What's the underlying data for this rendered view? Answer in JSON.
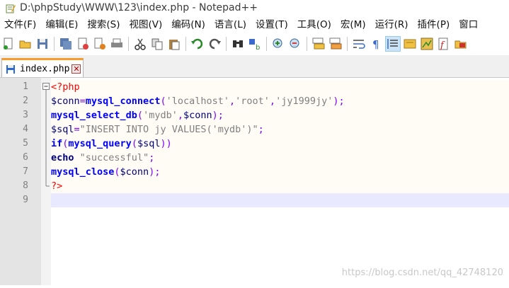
{
  "window": {
    "title": "D:\\phpStudy\\WWW\\123\\index.php - Notepad++"
  },
  "menu": {
    "items": [
      "文件(F)",
      "编辑(E)",
      "搜索(S)",
      "视图(V)",
      "编码(N)",
      "语言(L)",
      "设置(T)",
      "工具(O)",
      "宏(M)",
      "运行(R)",
      "插件(P)",
      "窗口"
    ]
  },
  "toolbar": {
    "icons": [
      "new-file-icon",
      "open-file-icon",
      "save-icon",
      "save-all-icon",
      "close-icon",
      "close-all-icon",
      "print-icon",
      "cut-icon",
      "copy-icon",
      "paste-icon",
      "undo-icon",
      "redo-icon",
      "find-icon",
      "replace-icon",
      "zoom-in-icon",
      "zoom-out-icon",
      "sync-vertical-icon",
      "sync-horizontal-icon",
      "word-wrap-icon",
      "show-all-chars-icon",
      "indent-guide-icon",
      "lang-icon",
      "doc-map-icon",
      "function-list-icon",
      "folder-as-workspace-icon"
    ]
  },
  "tab": {
    "label": "index.php",
    "close_glyph": "✕"
  },
  "editor": {
    "line_numbers": [
      "1",
      "2",
      "3",
      "4",
      "5",
      "6",
      "7",
      "8",
      "9"
    ],
    "lines": [
      [
        [
          "t-tag",
          "<?php"
        ]
      ],
      [
        [
          "t-var",
          "$conn"
        ],
        [
          "t-op",
          "="
        ],
        [
          "t-fn",
          "mysql_connect"
        ],
        [
          "t-op",
          "("
        ],
        [
          "t-str",
          "'localhost'"
        ],
        [
          "t-op",
          ","
        ],
        [
          "t-str",
          "'root'"
        ],
        [
          "t-op",
          ","
        ],
        [
          "t-str",
          "'jy1999jy'"
        ],
        [
          "t-op",
          ");"
        ]
      ],
      [
        [
          "t-fn",
          "mysql_select_db"
        ],
        [
          "t-op",
          "("
        ],
        [
          "t-str",
          "'mydb'"
        ],
        [
          "t-op",
          ","
        ],
        [
          "t-var",
          "$conn"
        ],
        [
          "t-op",
          ");"
        ]
      ],
      [
        [
          "t-var",
          "$sql"
        ],
        [
          "t-op",
          "="
        ],
        [
          "t-str",
          "\"INSERT INTO jy VALUES('mydb')\""
        ],
        [
          "t-op",
          ";"
        ]
      ],
      [
        [
          "t-kw",
          "if"
        ],
        [
          "t-op",
          "("
        ],
        [
          "t-fn",
          "mysql_query"
        ],
        [
          "t-op",
          "("
        ],
        [
          "t-var",
          "$sql"
        ],
        [
          "t-op",
          "))"
        ]
      ],
      [
        [
          "t-echo",
          "echo"
        ],
        [
          "t-op",
          " "
        ],
        [
          "t-str",
          "\"successful\""
        ],
        [
          "t-op",
          ";"
        ]
      ],
      [
        [
          "t-fn",
          "mysql_close"
        ],
        [
          "t-op",
          "("
        ],
        [
          "t-var",
          "$conn"
        ],
        [
          "t-op",
          ");"
        ]
      ],
      [
        [
          "t-tag",
          "?>"
        ]
      ],
      []
    ]
  },
  "watermark": "https://blog.csdn.net/qq_42748120"
}
